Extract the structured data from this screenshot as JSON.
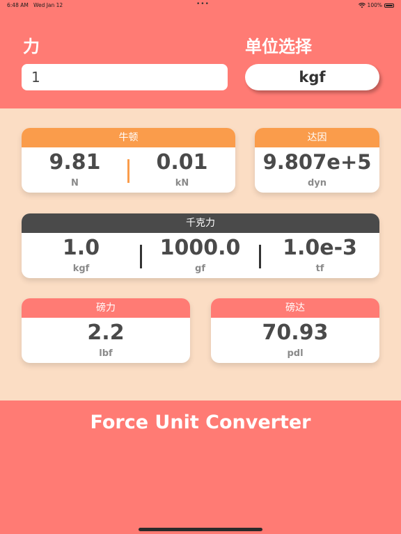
{
  "status": {
    "time": "6:48 AM",
    "date": "Wed Jan 12",
    "dots": "•••",
    "battery": "100%"
  },
  "input": {
    "force_label": "力",
    "force_value": "1",
    "unit_label": "单位选择",
    "unit_value": "kgf"
  },
  "cards": {
    "newton": {
      "title": "牛顿",
      "values": [
        {
          "value": "9.81",
          "unit": "N"
        },
        {
          "value": "0.01",
          "unit": "kN"
        }
      ]
    },
    "dyne": {
      "title": "达因",
      "values": [
        {
          "value": "9.807e+5",
          "unit": "dyn"
        }
      ]
    },
    "kgf": {
      "title": "千克力",
      "values": [
        {
          "value": "1.0",
          "unit": "kgf"
        },
        {
          "value": "1000.0",
          "unit": "gf"
        },
        {
          "value": "1.0e-3",
          "unit": "tf"
        }
      ]
    },
    "lbf": {
      "title": "磅力",
      "values": [
        {
          "value": "2.2",
          "unit": "lbf"
        }
      ]
    },
    "pdl": {
      "title": "磅达",
      "values": [
        {
          "value": "70.93",
          "unit": "pdl"
        }
      ]
    }
  },
  "footer": {
    "title": "Force Unit Converter"
  },
  "colors": {
    "header_bg": "#FF7B74",
    "content_bg": "#FBDDC4",
    "orange": "#FA9C4B",
    "dark": "#4A4A4A",
    "salmon": "#FF7B74"
  }
}
